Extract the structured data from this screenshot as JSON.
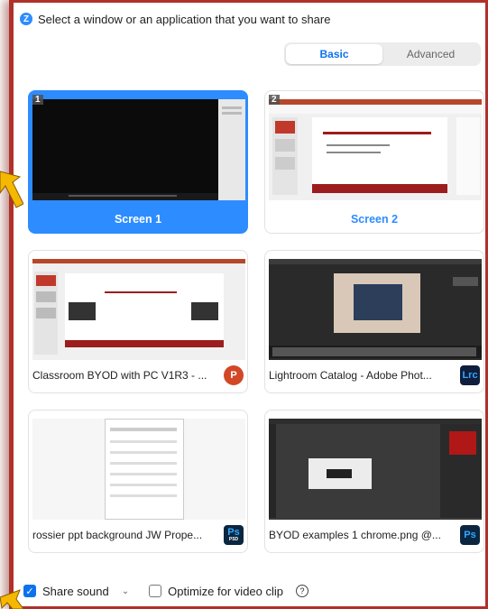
{
  "window": {
    "title": "Select a window or an application that you want to share",
    "logo_letter": "Z"
  },
  "tabs": [
    {
      "label": "Basic",
      "active": true
    },
    {
      "label": "Advanced",
      "active": false
    }
  ],
  "screens": [
    {
      "label": "Screen 1",
      "number": "1",
      "selected": true
    },
    {
      "label": "Screen 2",
      "number": "2",
      "selected": false
    }
  ],
  "apps": [
    {
      "label": "Classroom BYOD with PC V1R3 - ...",
      "icon": "P",
      "icon_color": "#d24726"
    },
    {
      "label": "Lightroom Catalog - Adobe Phot...",
      "icon": "Lrc",
      "icon_color": "#0f1e3c"
    },
    {
      "label": "rossier ppt background JW Prope...",
      "icon": "Ps",
      "icon_sub": "PSD",
      "icon_color": "#0b2640"
    },
    {
      "label": "BYOD examples 1 chrome.png @...",
      "icon": "Ps",
      "icon_color": "#0b2640"
    }
  ],
  "footer": {
    "share_sound_label": "Share sound",
    "share_sound_checked": true,
    "optimize_label": "Optimize for video clip",
    "optimize_checked": false,
    "help_glyph": "?"
  },
  "colors": {
    "accent": "#2d8cff",
    "frame": "#b0302a",
    "arrow": "#f5b800"
  }
}
